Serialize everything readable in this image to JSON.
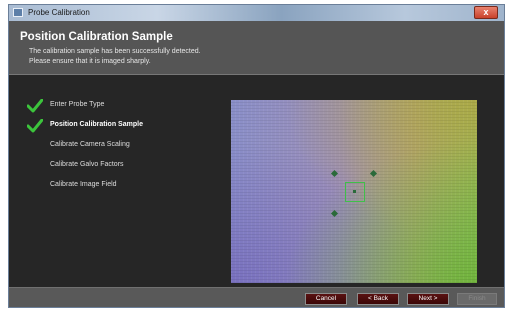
{
  "window": {
    "title": "Probe Calibration",
    "close_glyph": "x"
  },
  "header": {
    "title": "Position Calibration Sample",
    "line1": "The calibration sample has been successfully detected.",
    "line2": "Please ensure that it is imaged sharply."
  },
  "steps": [
    {
      "label": "Enter Probe Type",
      "done": true,
      "current": false
    },
    {
      "label": "Position Calibration Sample",
      "done": true,
      "current": true
    },
    {
      "label": "Calibrate Camera Scaling",
      "done": false,
      "current": false
    },
    {
      "label": "Calibrate Galvo Factors",
      "done": false,
      "current": false
    },
    {
      "label": "Calibrate Image Field",
      "done": false,
      "current": false
    }
  ],
  "colors": {
    "check": "#3cc43c",
    "target": "#3fbf4a",
    "button": "#4a0b0b"
  },
  "buttons": {
    "cancel": "Cancel",
    "back": "< Back",
    "next": "Next >",
    "finish": "Finish"
  }
}
